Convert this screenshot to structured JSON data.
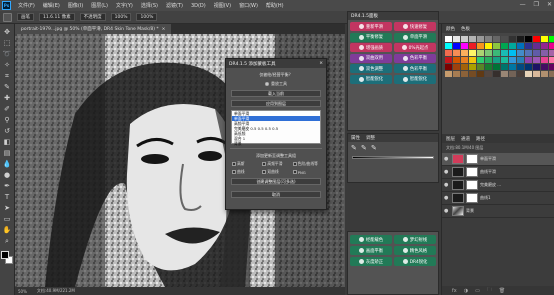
{
  "menubar": {
    "logo": "Ps",
    "items": [
      "文件(F)",
      "编辑(E)",
      "图像(I)",
      "图层(L)",
      "文字(Y)",
      "选择(S)",
      "滤镜(T)",
      "3D(D)",
      "视图(V)",
      "窗口(W)",
      "帮助(H)"
    ],
    "controls": [
      "—",
      "❐",
      "✕"
    ]
  },
  "options": {
    "mode_label": "画笔",
    "size_value": "11.6.11 像素",
    "blend_label": "不透明度",
    "opacity_value": "100%",
    "flow_value": "100%"
  },
  "document_tab": {
    "label": "portrait-1979...jpg @ 50% (单面平滑, DR4 Skin Tone Mask/8) *",
    "close": "×"
  },
  "statusbar": {
    "zoom": "50%",
    "doc_size": "文档:40.9M/221.2M"
  },
  "dialog": {
    "title": "DR4.1.5 添加蒙板工具",
    "close": "×",
    "prompt": "仅被绘/经营平衡？",
    "radio_label": "重放工具",
    "button_1": "载入当前",
    "button_2": "应用到图层",
    "list_items": [
      "单面平滑",
      "单面平滑",
      "高频平滑",
      "完美磨皮 0.5  0.5  0.5  0.5",
      "高低频",
      "混合 1",
      "背景"
    ],
    "list_selected_index": 1,
    "section_label": "添加更新至调整工具组",
    "checks": [
      "高斯",
      "高频平滑",
      "色阶/曲线等",
      "曲线",
      "双曲线",
      "PNG"
    ],
    "button_3": "创建调整图层(可多选)",
    "button_4": "取消"
  },
  "drpanel": {
    "tab": "DR4.1.5面板",
    "buttons": [
      {
        "label": "重新平滑",
        "color": "pink"
      },
      {
        "label": "快速修复",
        "color": "pink"
      },
      {
        "label": "平衡修复",
        "color": "green"
      },
      {
        "label": "单面平滑",
        "color": "green"
      },
      {
        "label": "增强画质",
        "color": "pink"
      },
      {
        "label": "0%光起点",
        "color": "pink"
      },
      {
        "label": "双曲双用",
        "color": "purple"
      },
      {
        "label": "色彩平衡",
        "color": "purple"
      },
      {
        "label": "双色调整",
        "color": "teal"
      },
      {
        "label": "色彩平衡",
        "color": "teal"
      },
      {
        "label": "智能锐化",
        "color": "teal"
      },
      {
        "label": "智能锐化",
        "color": "teal"
      }
    ]
  },
  "colorpanel": {
    "tabs": [
      "颜色",
      "色板"
    ]
  },
  "adjpanel": {
    "tabs": [
      "属性",
      "调整"
    ],
    "eyes": [
      "✎",
      "✎",
      "✎"
    ]
  },
  "drpanel2": {
    "buttons": [
      {
        "label": "经能载色",
        "color": "green"
      },
      {
        "label": "梦幻射线",
        "color": "green"
      },
      {
        "label": "画面平衡",
        "color": "green"
      },
      {
        "label": "精色风格",
        "color": "green"
      },
      {
        "label": "灰度矫正",
        "color": "green"
      },
      {
        "label": "DR4锐化",
        "color": "green"
      }
    ]
  },
  "layerspanel": {
    "tabs": [
      "图层",
      "通道",
      "路径"
    ],
    "info": "文档:80.1M/40 图层",
    "layers": [
      {
        "name": "单面平滑",
        "thumb": "pinkbg",
        "selected": true
      },
      {
        "name": "曲线平滑",
        "thumb": "dark",
        "selected": false
      },
      {
        "name": "完美磨皮 ...",
        "thumb": "dark",
        "selected": false
      },
      {
        "name": "曲线1",
        "thumb": "dark",
        "selected": false
      },
      {
        "name": "背景",
        "thumb": "photo",
        "selected": false
      }
    ],
    "footer": [
      "fx",
      "◑",
      "▭",
      "🗀",
      "🗑"
    ]
  },
  "swatch_colors": [
    "#ffffff",
    "#e6e6e6",
    "#cccccc",
    "#b3b3b3",
    "#999999",
    "#808080",
    "#666666",
    "#4d4d4d",
    "#333333",
    "#1a1a1a",
    "#000000",
    "#ff0000",
    "#ffff00",
    "#00ff00",
    "#00ffff",
    "#0000ff",
    "#ff00ff",
    "#ed1c24",
    "#f7941d",
    "#fff200",
    "#8dc63f",
    "#00a651",
    "#00a99d",
    "#0072bc",
    "#2e3192",
    "#662d91",
    "#92278f",
    "#ec008c",
    "#f26c4f",
    "#f68e56",
    "#fbaf5d",
    "#fff568",
    "#acd372",
    "#7cc576",
    "#3bb878",
    "#1abbb4",
    "#00bff3",
    "#438cca",
    "#5574b9",
    "#605ca8",
    "#855fa8",
    "#a763a8",
    "#c4161c",
    "#d35400",
    "#e67e22",
    "#f1c40f",
    "#2ecc71",
    "#27ae60",
    "#16a085",
    "#1abc9c",
    "#3498db",
    "#2980b9",
    "#8e44ad",
    "#9b59b6",
    "#e84393",
    "#fd79a8",
    "#7b0000",
    "#a0410d",
    "#a3620a",
    "#aba000",
    "#598527",
    "#197b30",
    "#007236",
    "#00746b",
    "#0076a3",
    "#004a80",
    "#003471",
    "#1b1464",
    "#440e62",
    "#630460",
    "#c69c6d",
    "#a67c52",
    "#8c6239",
    "#754c24",
    "#603913",
    "#534741",
    "#362f2d",
    "#998675",
    "#736357",
    "#4a3f3a",
    "#e8d4b8",
    "#d9b99b",
    "#b0906f",
    "#8a6e55"
  ]
}
